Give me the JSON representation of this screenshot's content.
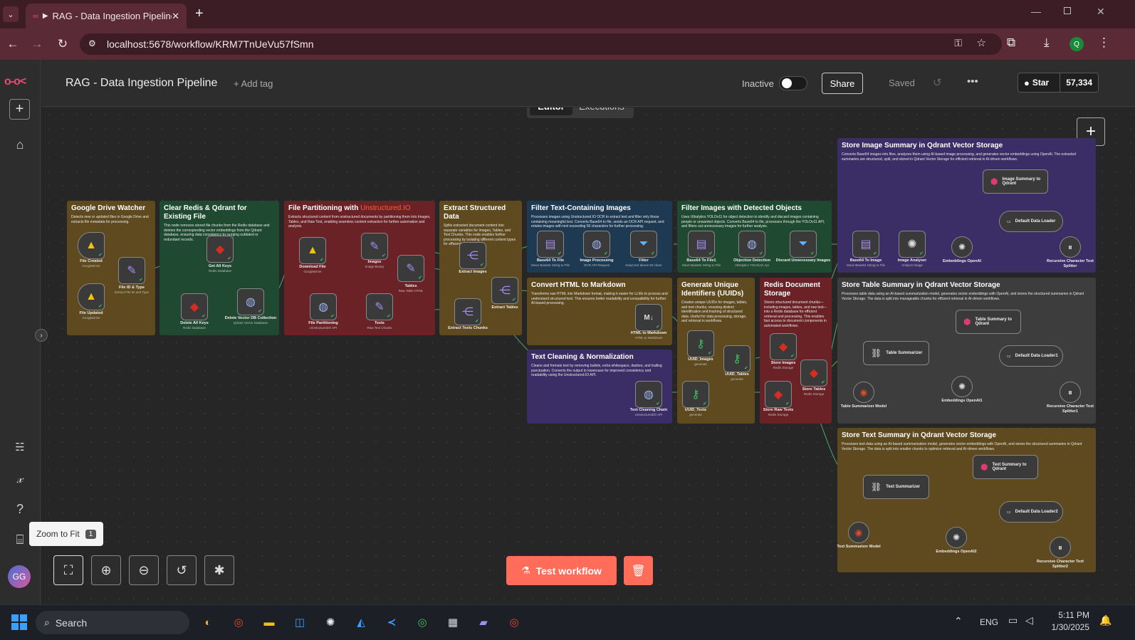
{
  "browser": {
    "tab_title": "RAG - Data Ingestion Pipeline",
    "url": "localhost:5678/workflow/KRM7TnUeVu57fSmn",
    "profile_initial": "Q"
  },
  "header": {
    "workflow_name": "RAG - Data Ingestion Pipeline",
    "add_tag": "+ Add tag",
    "status": "Inactive",
    "share": "Share",
    "saved": "Saved",
    "star": "Star",
    "star_count": "57,334"
  },
  "tabs": {
    "editor": "Editor",
    "executions": "Executions"
  },
  "sidebar": {
    "avatar": "GG",
    "tooltip": "Zoom to Fit",
    "tooltip_key": "1"
  },
  "actions": {
    "test_workflow": "Test workflow"
  },
  "notes": {
    "gdrive": {
      "title": "Google Drive Watcher",
      "desc": "Detects new or updated files in Google Drive and extracts file metadata for processing."
    },
    "clear": {
      "title": "Clear Redis & Qdrant for Existing File",
      "desc": "This node removes stored file chunks from the Redis database and deletes the corresponding vector embeddings from the Qdrant database, ensuring data consistency by purging outdated or redundant records."
    },
    "partition": {
      "title": "File Partitioning with ",
      "title_hl": "Unstructured.IO",
      "desc": "Extracts structured content from unstructured documents by partitioning them into Images, Tables, and Raw Text, enabling seamless content extraction for further automation and analysis."
    },
    "extract": {
      "title": "Extract Structured Data",
      "desc": "Splits extracted document content into separate variables for Images, Tables, and Text Chunks. This node enables further processing by isolating different content types for efficient data handling."
    },
    "filtertext": {
      "title": "Filter Text-Containing Images",
      "desc": "Processes images using Unstructured.IO OCR to extract text and filter only those containing meaningful text. Converts Base64 to file, sends an OCR API request, and retains images with text exceeding 50 characters for further processing."
    },
    "filterobj": {
      "title": "Filter Images with Detected Objects",
      "desc": "Uses Ultralytics YOLOv11 for object detection to identify and discard images containing people or unwanted objects. Converts Base64 to file, processes through the YOLOv11 API, and filters out unnecessary images for further analysis."
    },
    "html": {
      "title": "Convert HTML to Markdown",
      "desc": "Transforms raw HTML into Markdown format, making it easier for LLMs to process and understand structured text. This ensures better readability and compatibility for further AI-based processing."
    },
    "clean": {
      "title": "Text Cleaning & Normalization",
      "desc": "Cleans and formats text by removing bullets, extra whitespace, dashes, and trailing punctuation. Converts the output to lowercase for improved consistency and readability using the Unstructured.IO API."
    },
    "uuid": {
      "title": "Generate Unique Identifiers (UUIDs)",
      "desc": "Creates unique UUIDs for images, tables, and text chunks, ensuring distinct identification and tracking of structured data. Useful for data processing, storage, and retrieval in workflows."
    },
    "redis": {
      "title": "Redis Document Storage",
      "desc": "Stores structured document chunks—including images, tables, and raw text—into a Redis database for efficient retrieval and processing. This enables fast access to document components in automated workflows."
    },
    "qimg": {
      "title": "Store Image Summary in Qdrant Vector Storage",
      "desc": "Converts Base64 images into files, analyzes them using AI-based image processing, and generates vector embeddings using OpenAI. The extracted summaries are structured, split, and stored in Qdrant Vector Storage for efficient retrieval in AI-driven workflows."
    },
    "qtable": {
      "title": "Store Table Summary in Qdrant Vector Storage",
      "desc": "Processes table data using an AI-based summarization model, generates vector embeddings with OpenAI, and stores the structured summaries in Qdrant Vector Storage. The data is split into manageable chunks for efficient retrieval in AI-driven workflows."
    },
    "qtext": {
      "title": "Store Text Summary in Qdrant Vector Storage",
      "desc": "Processes text data using an AI-based summarization model, generates vector embeddings with OpenAI, and stores the structured summaries in Qdrant Vector Storage. The data is split into smaller chunks to optimize retrieval and AI-driven workflows."
    }
  },
  "nodes": {
    "file_created": {
      "label": "File Created",
      "sub": "GoogleDrive"
    },
    "file_updated": {
      "label": "File Updated",
      "sub": "GoogleDrive"
    },
    "file_id_type": {
      "label": "File ID & Type",
      "sub": "Extract File ID and Type"
    },
    "get_all_keys": {
      "label": "Get All Keys",
      "sub": "Redis Database"
    },
    "delete_all_keys": {
      "label": "Delete All Keys",
      "sub": "Redis Database"
    },
    "delete_vector": {
      "label": "Delete Vector DB Collection",
      "sub": "Qdrant Vector Database"
    },
    "download_file": {
      "label": "Download File",
      "sub": "GoogleDrive"
    },
    "images": {
      "label": "Images",
      "sub": "Image Binary"
    },
    "tables": {
      "label": "Tables",
      "sub": "Raw Table HTML"
    },
    "file_partitioning": {
      "label": "File Partitioning",
      "sub": "UnstructuredIO API"
    },
    "texts": {
      "label": "Texts",
      "sub": "Raw Text Chunks"
    },
    "extract_images": {
      "label": "Extract Images",
      "sub": ""
    },
    "extract_tables": {
      "label": "Extract Tables",
      "sub": ""
    },
    "extract_texts": {
      "label": "Extract Texts Chunks",
      "sub": ""
    },
    "b64_file": {
      "label": "Base64 To File",
      "sub": "Move Base64 String to File"
    },
    "image_processing": {
      "label": "Image Processing",
      "sub": "OCR API Request"
    },
    "filter": {
      "label": "Filter",
      "sub": "Keep text above 50 chars"
    },
    "b64_file1": {
      "label": "Base64 To File1",
      "sub": "Move Base64 String to File"
    },
    "object_detection": {
      "label": "Objection Detection",
      "sub": "Ultralytics YOLOv11 Api"
    },
    "discard": {
      "label": "Discard Unnecessary Images",
      "sub": ""
    },
    "html_md": {
      "label": "HTML to Markdown",
      "sub": "HTML to Markdown"
    },
    "text_cleaning": {
      "label": "Text Cleaning Chain",
      "sub": "UnstructuredIO API"
    },
    "uuid_images": {
      "label": "UUID_Images",
      "sub": "generate"
    },
    "uuid_tables": {
      "label": "UUID_Tables",
      "sub": "generate"
    },
    "uuid_texts": {
      "label": "UUID_Texts",
      "sub": "generate"
    },
    "store_images": {
      "label": "Store Images",
      "sub": "Redis Storage"
    },
    "store_tables": {
      "label": "Store Tables",
      "sub": "Redis Storage"
    },
    "store_raw_texts": {
      "label": "Store Raw Texts",
      "sub": "Redis Storage"
    },
    "b64_image": {
      "label": "Base64 To Image",
      "sub": "Move Base64 String to File"
    },
    "image_analyser": {
      "label": "Image Analyser",
      "sub": "Analyze Image"
    },
    "image_summary_q": {
      "label": "Image Summary to Qdrant",
      "sub": ""
    },
    "default_loader": {
      "label": "Default Data Loader",
      "sub": ""
    },
    "embeddings": {
      "label": "Embeddings OpenAI",
      "sub": ""
    },
    "splitter": {
      "label": "Recursive Character Text Splitter",
      "sub": ""
    },
    "table_summarizer": {
      "label": "Table Summarizer",
      "sub": ""
    },
    "table_summary_q": {
      "label": "Table Summary to Qdrant",
      "sub": ""
    },
    "default_loader1": {
      "label": "Default Data Loader1",
      "sub": ""
    },
    "table_model": {
      "label": "Table Summarizer Model",
      "sub": ""
    },
    "embeddings1": {
      "label": "Embeddings OpenAI1",
      "sub": ""
    },
    "splitter1": {
      "label": "Recursive Character Text Splitter1",
      "sub": ""
    },
    "text_summarizer": {
      "label": "Text Summarizer",
      "sub": ""
    },
    "text_summary_q": {
      "label": "Text Summary to Qdrant",
      "sub": ""
    },
    "default_loader2": {
      "label": "Default Data Loader2",
      "sub": ""
    },
    "text_model": {
      "label": "Text Summarizer Model",
      "sub": ""
    },
    "embeddings2": {
      "label": "Embeddings OpenAI2",
      "sub": ""
    },
    "splitter2": {
      "label": "Recursive Character Text Splitter2",
      "sub": ""
    }
  },
  "taskbar": {
    "search": "Search",
    "lang": "ENG",
    "time": "5:11 PM",
    "date": "1/30/2025"
  },
  "colors": {
    "accent": "#ea4b71",
    "test_button": "#ff6d5a",
    "note_yellow": "#5e4a1e",
    "note_green": "#1f4a31",
    "note_red": "#6b2226",
    "note_blue": "#1e3a52",
    "note_purple": "#3b2e66",
    "note_gray": "#3d3d3d"
  }
}
